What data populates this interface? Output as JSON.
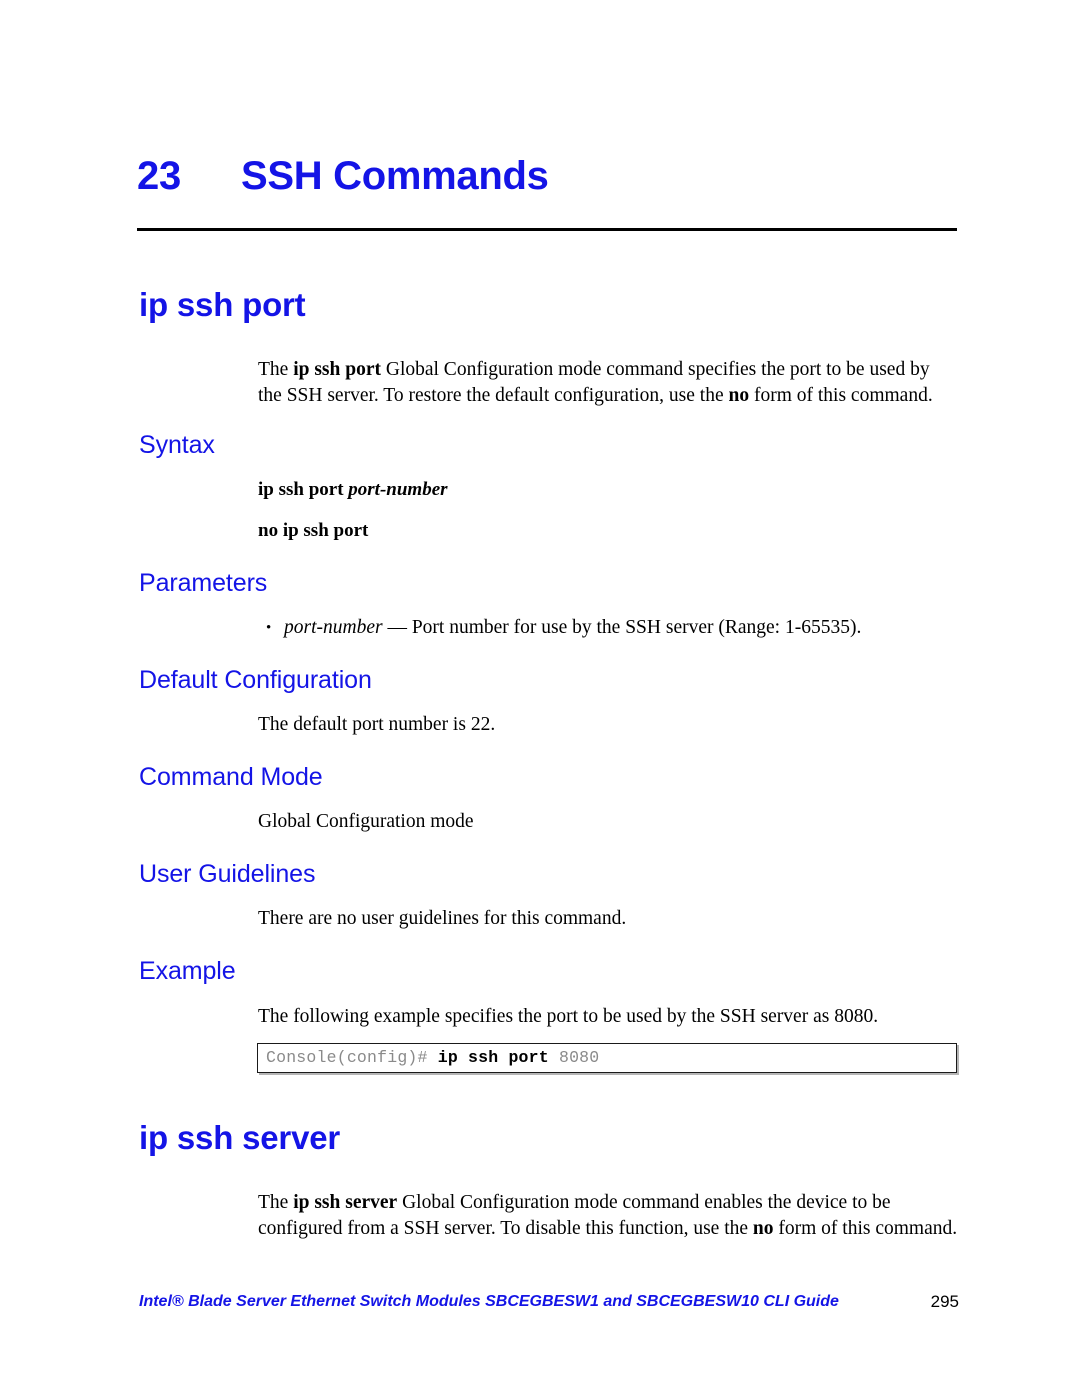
{
  "colors": {
    "heading_blue": "#1414e6",
    "body_black": "#000000",
    "code_gray": "#8a8a8a",
    "rule_black": "#000000"
  },
  "chapter": {
    "number": "23",
    "title": "SSH Commands"
  },
  "commands": [
    {
      "name": "ip ssh port",
      "intro_prefix": "The ",
      "intro_bold_1": "ip ssh port",
      "intro_mid": " Global Configuration mode command specifies the port to be used by the SSH server. To restore the default configuration, use the ",
      "intro_bold_2": "no",
      "intro_suffix": " form of this command.",
      "sections": {
        "syntax_heading": "Syntax",
        "syntax_line_1_cmd": "ip ssh port ",
        "syntax_line_1_param": "port-number",
        "syntax_line_2": "no ip ssh port",
        "parameters_heading": "Parameters",
        "parameter_bullet": "•",
        "parameter_name": "port-number",
        "parameter_desc": " — Port number for use by the SSH server (Range: 1-65535).",
        "default_heading": "Default Configuration",
        "default_text": "The default port number is 22.",
        "mode_heading": "Command Mode",
        "mode_text": "Global Configuration mode",
        "guidelines_heading": "User Guidelines",
        "guidelines_text": "There are no user guidelines for this command.",
        "example_heading": "Example",
        "example_text": "The following example specifies the port to be used by the SSH server as 8080."
      },
      "code_block": {
        "prompt": "Console(config)# ",
        "command": "ip ssh port",
        "argument": " 8080"
      }
    },
    {
      "name": "ip ssh server",
      "intro_prefix": "The ",
      "intro_bold_1": "ip ssh server",
      "intro_mid": " Global Configuration mode command enables the device to be configured from a SSH server. To disable this function, use the ",
      "intro_bold_2": "no",
      "intro_suffix": " form of this command."
    }
  ],
  "footer": {
    "text": "Intel® Blade Server Ethernet Switch Modules SBCEGBESW1 and SBCEGBESW10 CLI Guide",
    "page_number": "295"
  }
}
